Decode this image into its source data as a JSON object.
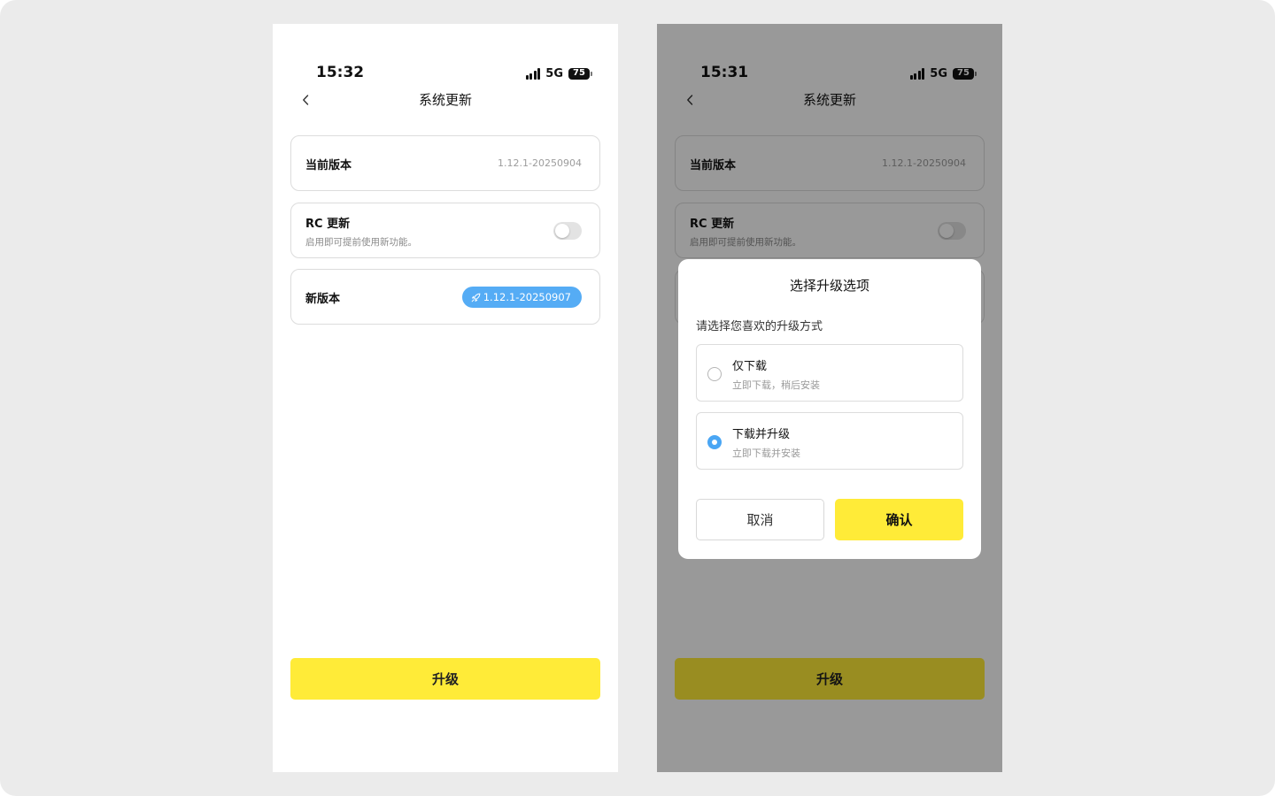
{
  "colors": {
    "accent_yellow": "#ffeb38",
    "badge_blue": "#55acf5",
    "radio_blue": "#4aa6f4",
    "backdrop": "#ebebeb"
  },
  "screens": [
    {
      "status": {
        "time": "15:32",
        "network": "5G",
        "battery": "75"
      },
      "nav": {
        "title": "系统更新",
        "back_icon": "chevron-left-icon"
      },
      "current_version": {
        "label": "当前版本",
        "value": "1.12.1-20250904"
      },
      "rc_update": {
        "label": "RC 更新",
        "description": "启用即可提前使用新功能。",
        "enabled": false
      },
      "new_version": {
        "label": "新版本",
        "value": "1.12.1-20250907",
        "icon": "rocket-icon"
      },
      "upgrade_button": "升级"
    },
    {
      "status": {
        "time": "15:31",
        "network": "5G",
        "battery": "75"
      },
      "nav": {
        "title": "系统更新",
        "back_icon": "chevron-left-icon"
      },
      "current_version": {
        "label": "当前版本",
        "value": "1.12.1-20250904"
      },
      "rc_update": {
        "label": "RC 更新",
        "description": "启用即可提前使用新功能。",
        "enabled": false
      },
      "upgrade_button": "升级",
      "dialog": {
        "title": "选择升级选项",
        "prompt": "请选择您喜欢的升级方式",
        "options": [
          {
            "title": "仅下载",
            "subtitle": "立即下载，稍后安装",
            "selected": false
          },
          {
            "title": "下载并升级",
            "subtitle": "立即下载并安装",
            "selected": true
          }
        ],
        "cancel": "取消",
        "confirm": "确认"
      }
    }
  ]
}
